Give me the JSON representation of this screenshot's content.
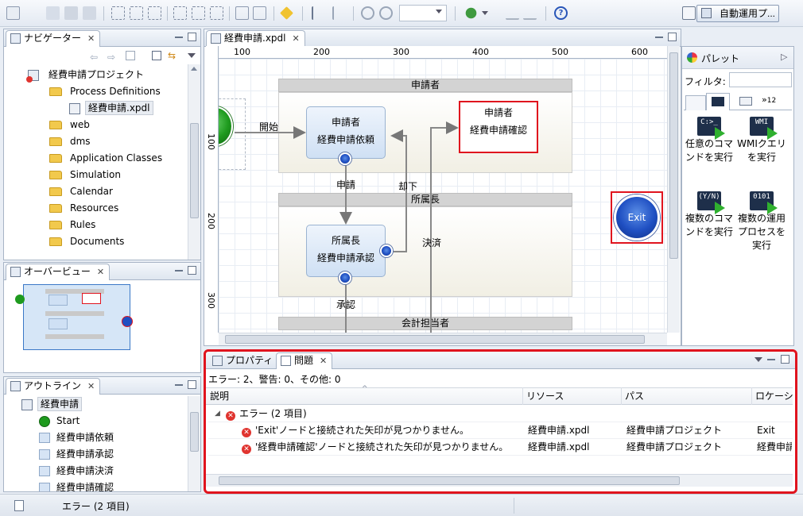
{
  "toolbar": {
    "perspective_label": "自動運用プ..."
  },
  "navigator": {
    "title": "ナビゲーター",
    "items": [
      {
        "label": "経費申請プロジェクト"
      },
      {
        "label": "Process Definitions"
      },
      {
        "label": "経費申請.xpdl"
      },
      {
        "label": "web"
      },
      {
        "label": "dms"
      },
      {
        "label": "Application Classes"
      },
      {
        "label": "Simulation"
      },
      {
        "label": "Calendar"
      },
      {
        "label": "Resources"
      },
      {
        "label": "Rules"
      },
      {
        "label": "Documents"
      }
    ]
  },
  "overview": {
    "title": "オーバービュー"
  },
  "outline": {
    "title": "アウトライン",
    "root": "経費申請",
    "items": [
      {
        "label": "Start"
      },
      {
        "label": "経費申請依頼"
      },
      {
        "label": "経費申請承認"
      },
      {
        "label": "経費申請決済"
      },
      {
        "label": "経費申請確認"
      }
    ]
  },
  "editor": {
    "tab_label": "経費申請.xpdl",
    "ruler_top": [
      "100",
      "200",
      "300",
      "400",
      "500",
      "600"
    ],
    "ruler_left": [
      "100",
      "200",
      "300"
    ],
    "lanes": [
      {
        "label": "申請者"
      },
      {
        "label": "所属長"
      },
      {
        "label": "会計担当者"
      }
    ],
    "activities": {
      "request": {
        "role": "申請者",
        "name": "経費申請依頼"
      },
      "confirm": {
        "role": "申請者",
        "name": "経費申請確認"
      },
      "approve": {
        "role": "所属長",
        "name": "経費申請承認"
      }
    },
    "edge_labels": {
      "start": "開始",
      "apply": "申請",
      "reject": "却下",
      "settle": "決済",
      "approve": "承認"
    },
    "exit_label": "Exit"
  },
  "palette": {
    "title": "パレット",
    "filter_label": "フィルタ:",
    "filter_value": "",
    "tab_count": "12",
    "entries": [
      {
        "label": "任意のコマンドを実行",
        "icon_text": "C:>_"
      },
      {
        "label": "WMIクエリを実行",
        "icon_text": "WMI"
      },
      {
        "label": "複数のコマンドを実行",
        "icon_text": "(Y/N)"
      },
      {
        "label": "複数の運用プロセスを実行",
        "icon_text": "0101"
      }
    ]
  },
  "bottom": {
    "tab_properties": "プロパティ",
    "tab_problems": "問題",
    "summary": "エラー: 2、警告: 0、その他: 0",
    "columns": [
      "説明",
      "リソース",
      "パス",
      "ロケーシ"
    ],
    "group_label": "エラー (2 項目)",
    "rows": [
      {
        "desc": "'Exit'ノードと接続された矢印が見つかりません。",
        "resource": "経費申請.xpdl",
        "path": "経費申請プロジェクト",
        "location": "Exit"
      },
      {
        "desc": "'経費申請確認'ノードと接続された矢印が見つかりません。",
        "resource": "経費申請.xpdl",
        "path": "経費申請プロジェクト",
        "location": "経費申請"
      }
    ]
  },
  "status_bar": {
    "text": "エラー (2 項目)"
  },
  "colors": {
    "accent_red": "#e0141e",
    "node_blue": "#1f4fc2",
    "start_green": "#1e9a1e"
  }
}
